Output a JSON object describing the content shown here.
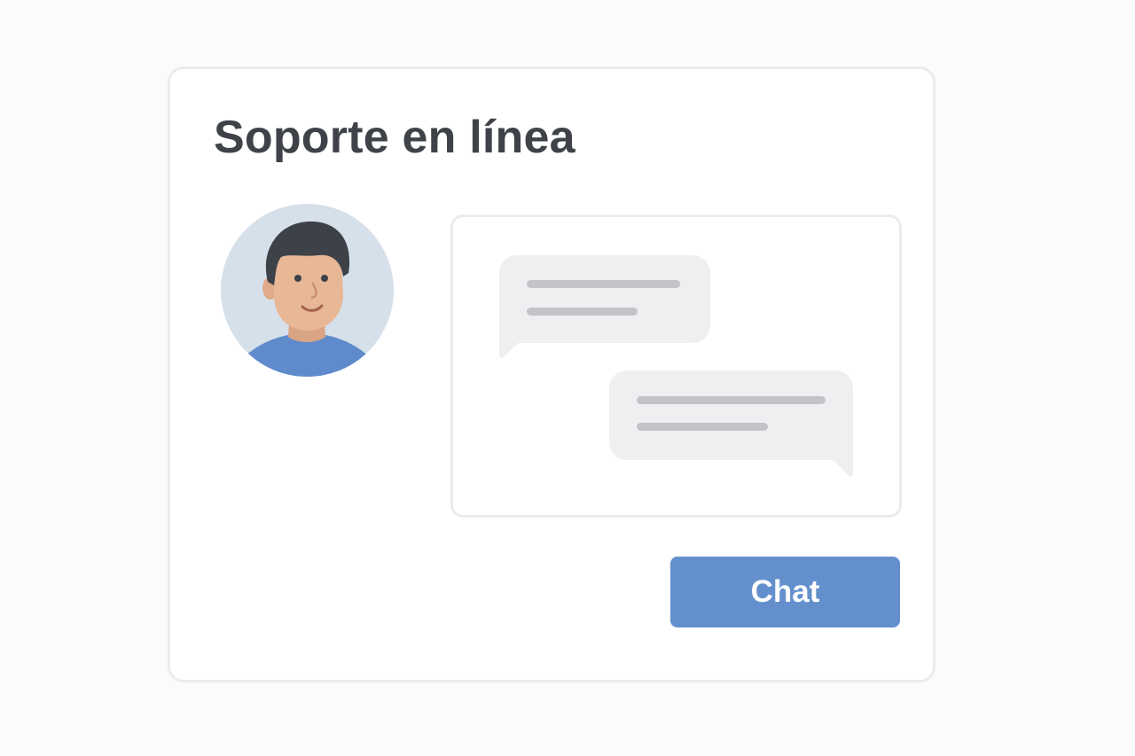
{
  "widget": {
    "title": "Soporte en línea",
    "button_label": "Chat"
  },
  "colors": {
    "accent": "#6390cc",
    "title_text": "#3f4349",
    "card_border": "#ececee",
    "bubble_fill": "#efeff1",
    "bubble_line": "#c2c4c8",
    "avatar_background": "#d6e0ea",
    "avatar_hair": "#3d4148",
    "avatar_skin": "#e8b796",
    "avatar_shirt": "#5f8bcc"
  },
  "icons": {
    "avatar": "support-agent-avatar",
    "messages": "chat-bubbles"
  }
}
